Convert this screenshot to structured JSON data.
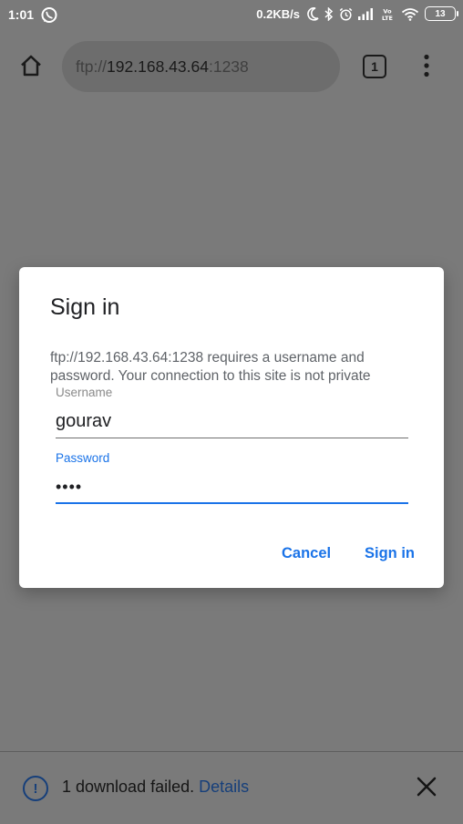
{
  "status_bar": {
    "time": "1:01",
    "network_speed": "0.2KB/s",
    "battery": "13",
    "icons": [
      "whatsapp-icon",
      "moon-icon",
      "bluetooth-icon",
      "alarm-icon",
      "signal-icon",
      "volte-icon",
      "wifi-icon",
      "battery-icon"
    ]
  },
  "toolbar": {
    "url_scheme": "ftp://",
    "url_host": "192.168.43.64",
    "url_port": ":1238",
    "tab_count": "1",
    "icons": [
      "home-icon",
      "more-vert-icon"
    ]
  },
  "dialog": {
    "title": "Sign in",
    "message": "ftp://192.168.43.64:1238 requires a username and password. Your connection to this site is not private",
    "username_label": "Username",
    "username_value": "gourav",
    "password_label": "Password",
    "password_value": "••••",
    "cancel_label": "Cancel",
    "signin_label": "Sign in"
  },
  "download_bar": {
    "message": "1 download failed.",
    "details_label": "Details",
    "icons": [
      "info-icon",
      "close-icon"
    ]
  },
  "colors": {
    "accent": "#1a73e8",
    "scrim_background": "#7a7a7a",
    "dialog_background": "#ffffff",
    "dark_link": "#163f7a"
  }
}
